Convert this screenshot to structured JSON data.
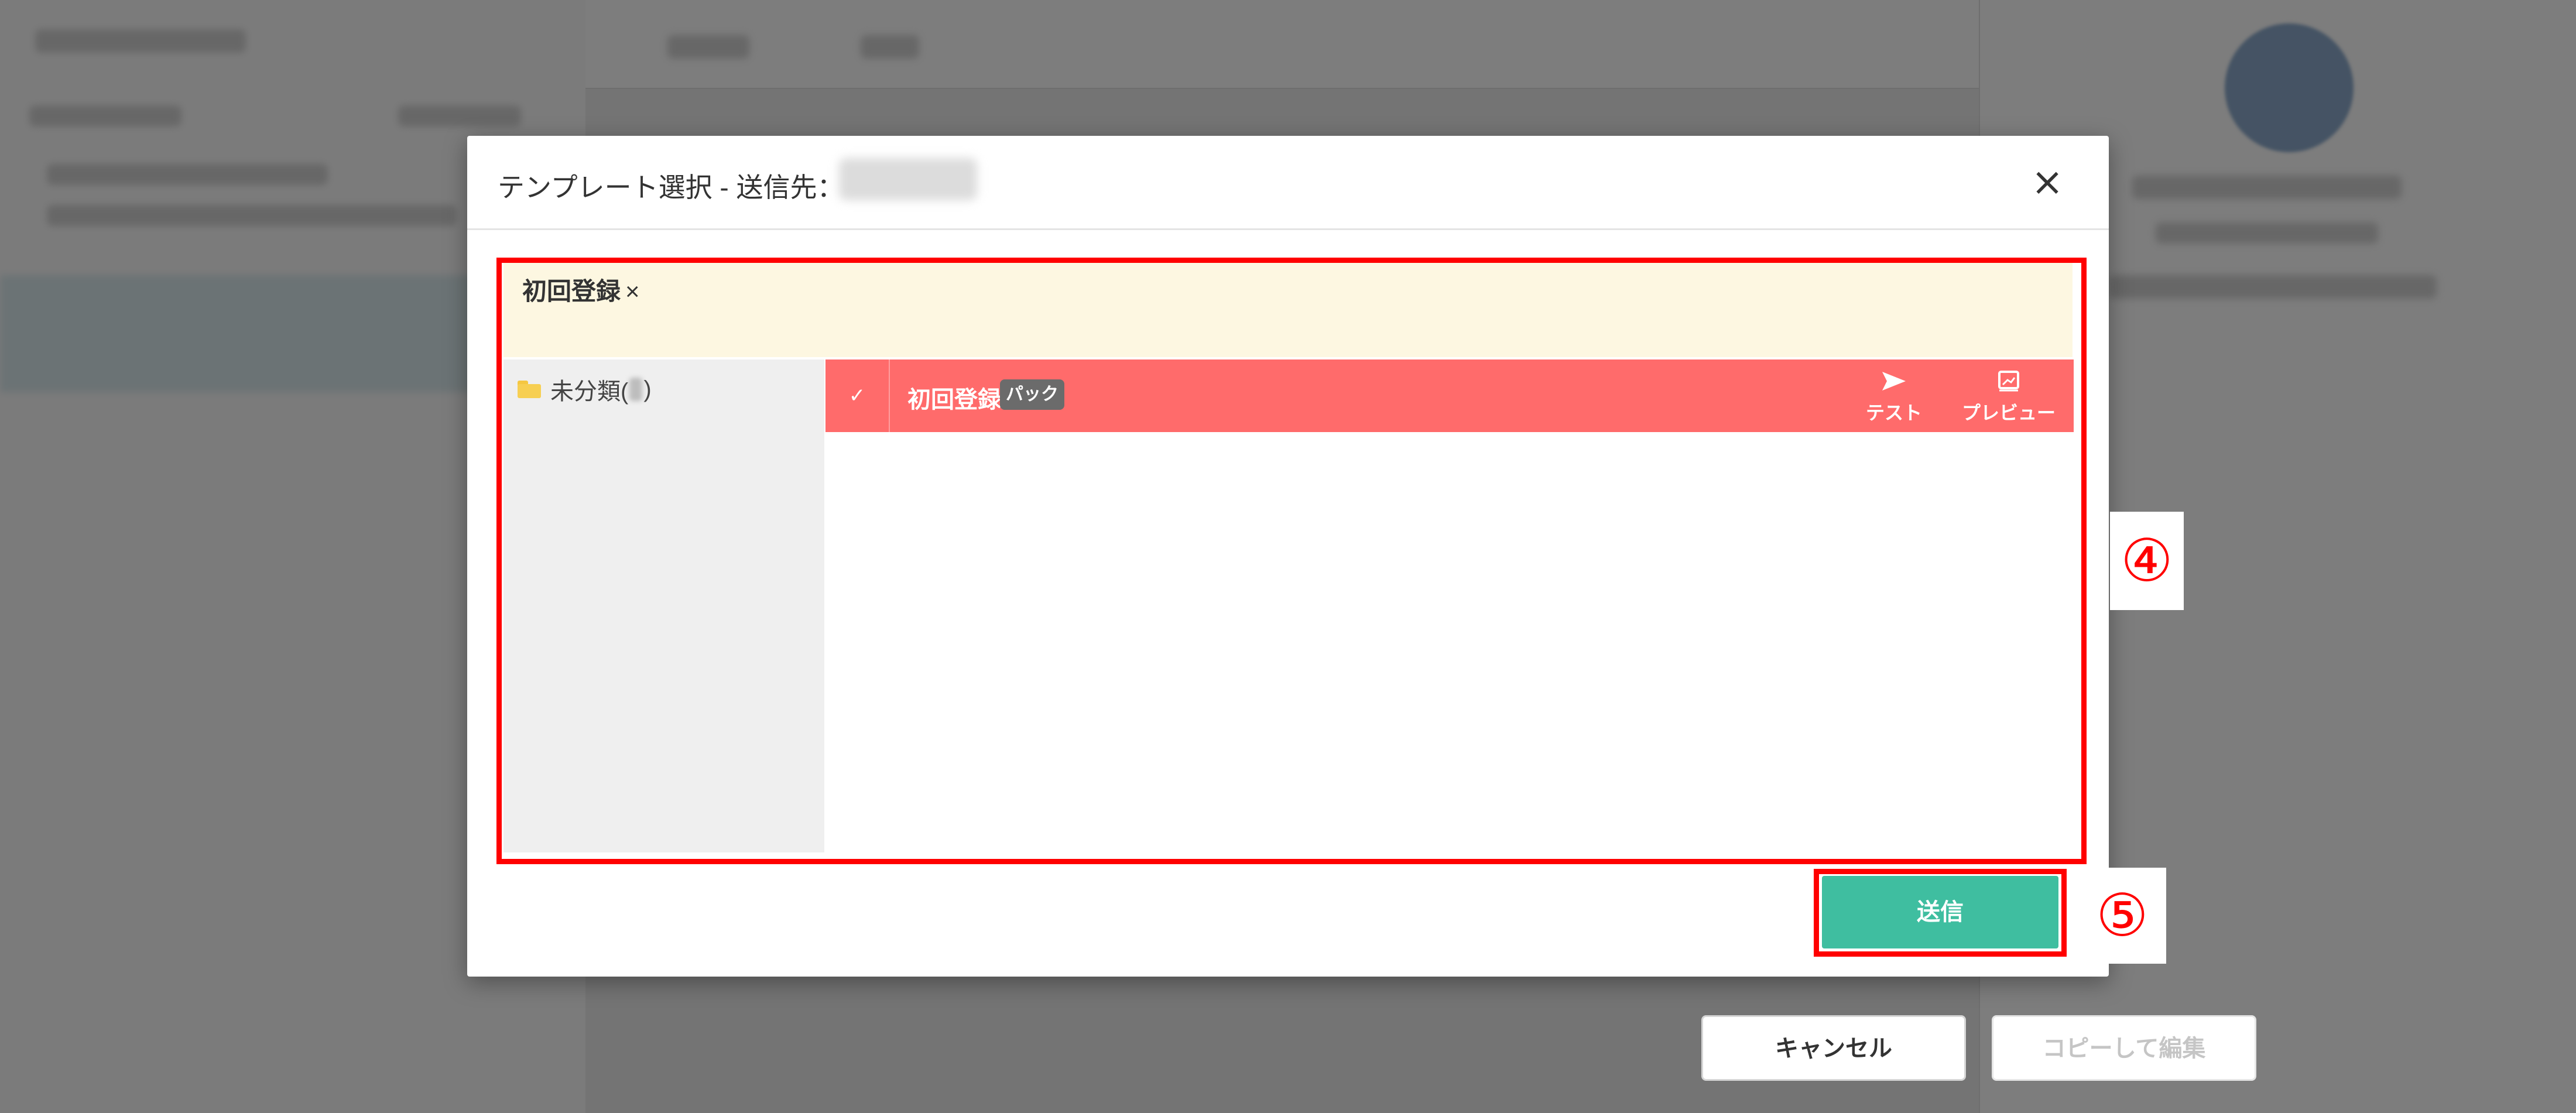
{
  "modal": {
    "title": "テンプレート選択 - 送信先：",
    "close_label": "×",
    "selected_tag": {
      "label": "初回登録",
      "remove_label": "×"
    },
    "folders": [
      {
        "label_prefix": "未分類(",
        "label_suffix": ")"
      }
    ],
    "templates": [
      {
        "check": "✓",
        "name": "初回登録",
        "badge": "パック",
        "actions": [
          {
            "label": "テスト",
            "icon": "send-icon"
          },
          {
            "label": "プレビュー",
            "icon": "preview-icon"
          }
        ]
      }
    ],
    "footer": {
      "cancel_label": "キャンセル",
      "copy_edit_label": "コピーして編集",
      "send_label": "送信"
    }
  },
  "annotations": {
    "step4": "④",
    "step5": "⑤",
    "color": "#ff0000"
  },
  "colors": {
    "selected_row": "#ff6b6b",
    "send_button": "#3fbea0",
    "tag_bar": "#fdf7e1",
    "folder_icon": "#f7cf52"
  }
}
